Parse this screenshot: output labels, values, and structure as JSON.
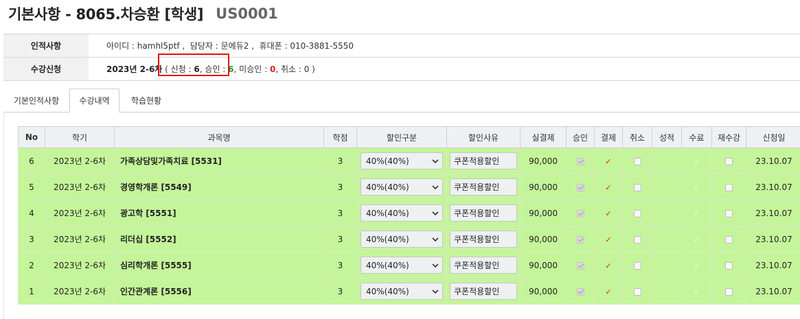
{
  "header": {
    "title": "기본사항 - 8065.차승환 [학생]",
    "code": "US0001"
  },
  "info": {
    "personal_label": "인적사항",
    "personal_value": "아이디 : hamhl5ptf ,  담당자 : 문에듀2 ,  휴대폰 : 010-3881-5550",
    "enroll_label": "수강신청",
    "enroll_prefix": "2023년 2-6차",
    "enroll_paren_open": " ( 신청 : ",
    "enroll_applied": "6",
    "enroll_approved_label": ", 승인 : ",
    "enroll_approved": "6",
    "enroll_pending_label": ", 미승인 : ",
    "enroll_pending": "0",
    "enroll_cancel_label": ", 취소 : ",
    "enroll_cancel": "0",
    "enroll_paren_close": " )"
  },
  "tabs": [
    {
      "label": "기본인적사항",
      "active": false
    },
    {
      "label": "수강내역",
      "active": true
    },
    {
      "label": "학습현황",
      "active": false
    }
  ],
  "table": {
    "headers": [
      "No",
      "학기",
      "과목명",
      "학점",
      "할인구분",
      "할인사유",
      "실결제",
      "승인",
      "결제",
      "취소",
      "성적",
      "수료",
      "재수강",
      "신청일"
    ],
    "rows": [
      {
        "no": "6",
        "term": "2023년 2-6차",
        "subject": "가족상담및가족치료 [5531]",
        "credit": "3",
        "discount": "40%(40%)",
        "reason": "쿠폰적용할인",
        "amount": "90,000",
        "approved": true,
        "paid": "✓",
        "canceled": false,
        "grade": "",
        "complete": "✓",
        "retake": false,
        "date": "23.10.07"
      },
      {
        "no": "5",
        "term": "2023년 2-6차",
        "subject": "경영학개론 [5549]",
        "credit": "3",
        "discount": "40%(40%)",
        "reason": "쿠폰적용할인",
        "amount": "90,000",
        "approved": true,
        "paid": "✓",
        "canceled": false,
        "grade": "",
        "complete": "✓",
        "retake": false,
        "date": "23.10.07"
      },
      {
        "no": "4",
        "term": "2023년 2-6차",
        "subject": "광고학 [5551]",
        "credit": "3",
        "discount": "40%(40%)",
        "reason": "쿠폰적용할인",
        "amount": "90,000",
        "approved": true,
        "paid": "✓",
        "canceled": false,
        "grade": "",
        "complete": "✓",
        "retake": false,
        "date": "23.10.07"
      },
      {
        "no": "3",
        "term": "2023년 2-6차",
        "subject": "리더십 [5552]",
        "credit": "3",
        "discount": "40%(40%)",
        "reason": "쿠폰적용할인",
        "amount": "90,000",
        "approved": true,
        "paid": "✓",
        "canceled": false,
        "grade": "",
        "complete": "✓",
        "retake": false,
        "date": "23.10.07"
      },
      {
        "no": "2",
        "term": "2023년 2-6차",
        "subject": "심리학개론 [5555]",
        "credit": "3",
        "discount": "40%(40%)",
        "reason": "쿠폰적용할인",
        "amount": "90,000",
        "approved": true,
        "paid": "✓",
        "canceled": false,
        "grade": "",
        "complete": "✓",
        "retake": false,
        "date": "23.10.07"
      },
      {
        "no": "1",
        "term": "2023년 2-6차",
        "subject": "인간관계론 [5556]",
        "credit": "3",
        "discount": "40%(40%)",
        "reason": "쿠폰적용할인",
        "amount": "90,000",
        "approved": true,
        "paid": "✓",
        "canceled": false,
        "grade": "",
        "complete": "✓",
        "retake": false,
        "date": "23.10.07"
      }
    ]
  },
  "icons": {
    "dropdown": "chevron-down-icon",
    "check": "check-icon"
  },
  "colors": {
    "row_bg": "#c5f59a",
    "header_bg": "#eef0f2",
    "highlight": "#e01010",
    "approved_text": "#1a9a1a",
    "pending_text": "#e02020"
  }
}
